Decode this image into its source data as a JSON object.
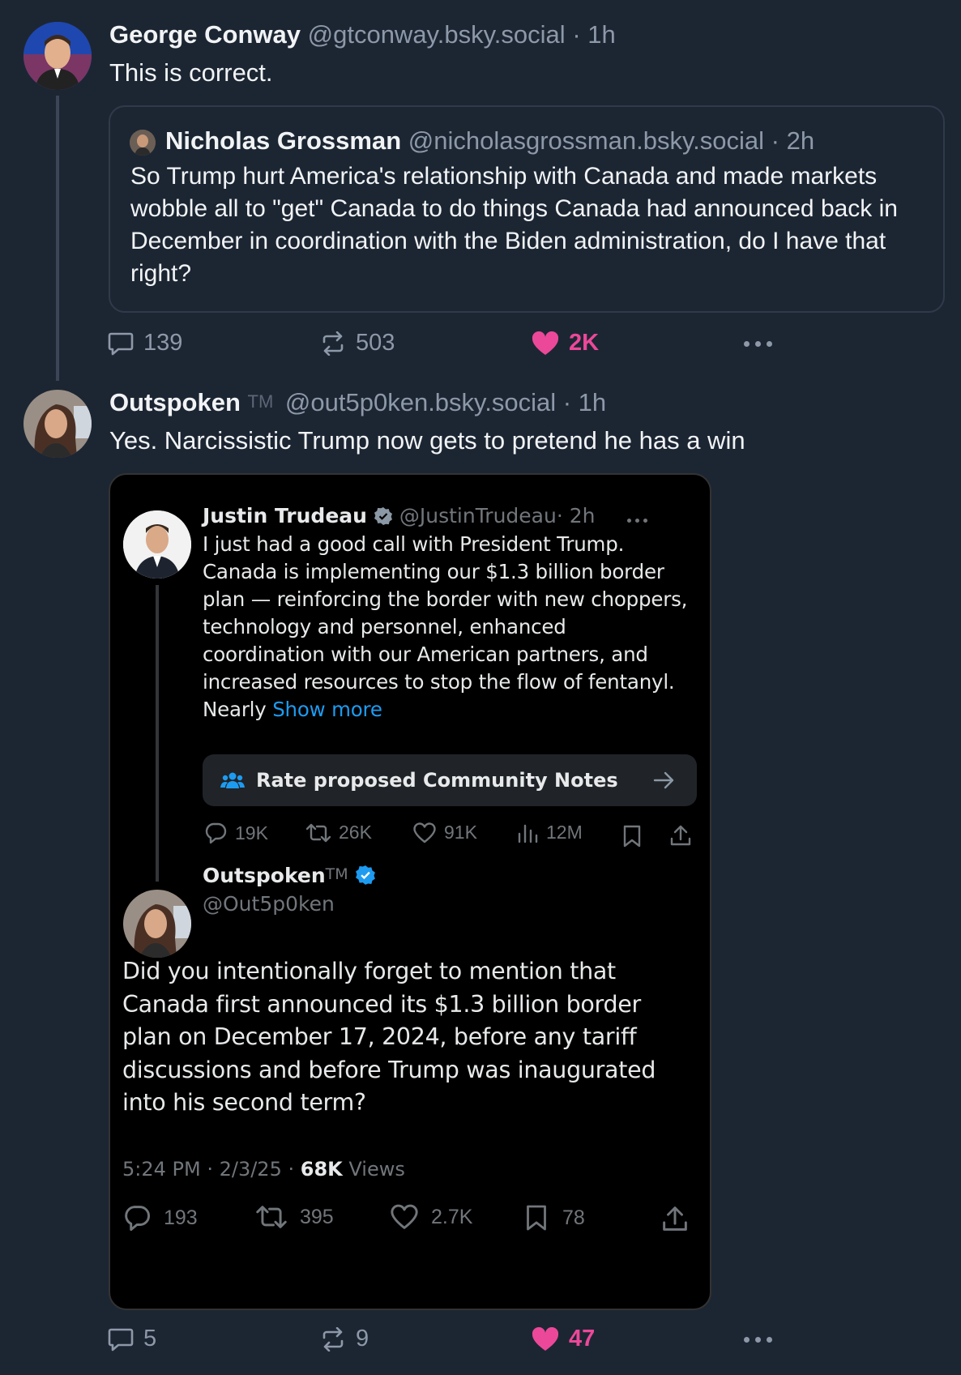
{
  "post1": {
    "author_name": "George Conway",
    "handle": "@gtconway.bsky.social",
    "time": "· 1h",
    "text": "This is correct.",
    "quote": {
      "author_name": "Nicholas Grossman",
      "handle": "@nicholasgrossman.bsky.social",
      "time": "· 2h",
      "text": "So Trump hurt America's relationship with Canada and made markets wobble all to \"get\" Canada to do things Canada had announced back in December in coordination with the Biden administration, do I have that right?"
    },
    "actions": {
      "replies": "139",
      "reposts": "503",
      "likes": "2K"
    }
  },
  "post2": {
    "author_name": "Outspoken",
    "tm": "TM",
    "handle": "@out5p0ken.bsky.social",
    "time": "· 1h",
    "text": "Yes. Narcissistic Trump now gets to pretend he has a win",
    "embedded_screenshot": {
      "tweet1": {
        "author_name": "Justin Trudeau",
        "handle": "@JustinTrudeau",
        "time": "· 2h",
        "text": "I just had a good call with President Trump. Canada is implementing our $1.3 billion border plan — reinforcing the border with new choppers, technology and personnel, enhanced coordination with our American partners, and increased resources to stop the flow of fentanyl. Nearly",
        "show_more": "Show more",
        "community_notes": "Rate proposed Community Notes",
        "stats": {
          "replies": "19K",
          "reposts": "26K",
          "likes": "91K",
          "views": "12M"
        }
      },
      "tweet2": {
        "author_name": "Outspoken",
        "tm": "TM",
        "handle": "@Out5p0ken",
        "text": "Did you intentionally forget to mention that Canada first announced its $1.3 billion border plan on December 17, 2024, before any tariff discussions and before Trump was inaugurated into his second term?",
        "timestamp": "5:24 PM · 2/3/25 ·",
        "views_count": "68K",
        "views_label": "Views",
        "stats": {
          "replies": "193",
          "reposts": "395",
          "likes": "2.7K",
          "bookmarks": "78"
        }
      }
    },
    "actions": {
      "replies": "5",
      "reposts": "9",
      "likes": "47"
    }
  },
  "colors": {
    "background": "#1c2633",
    "like_pink": "#ec4899",
    "x_link_blue": "#1d9bf0",
    "verified_blue": "#1d9bf0"
  }
}
